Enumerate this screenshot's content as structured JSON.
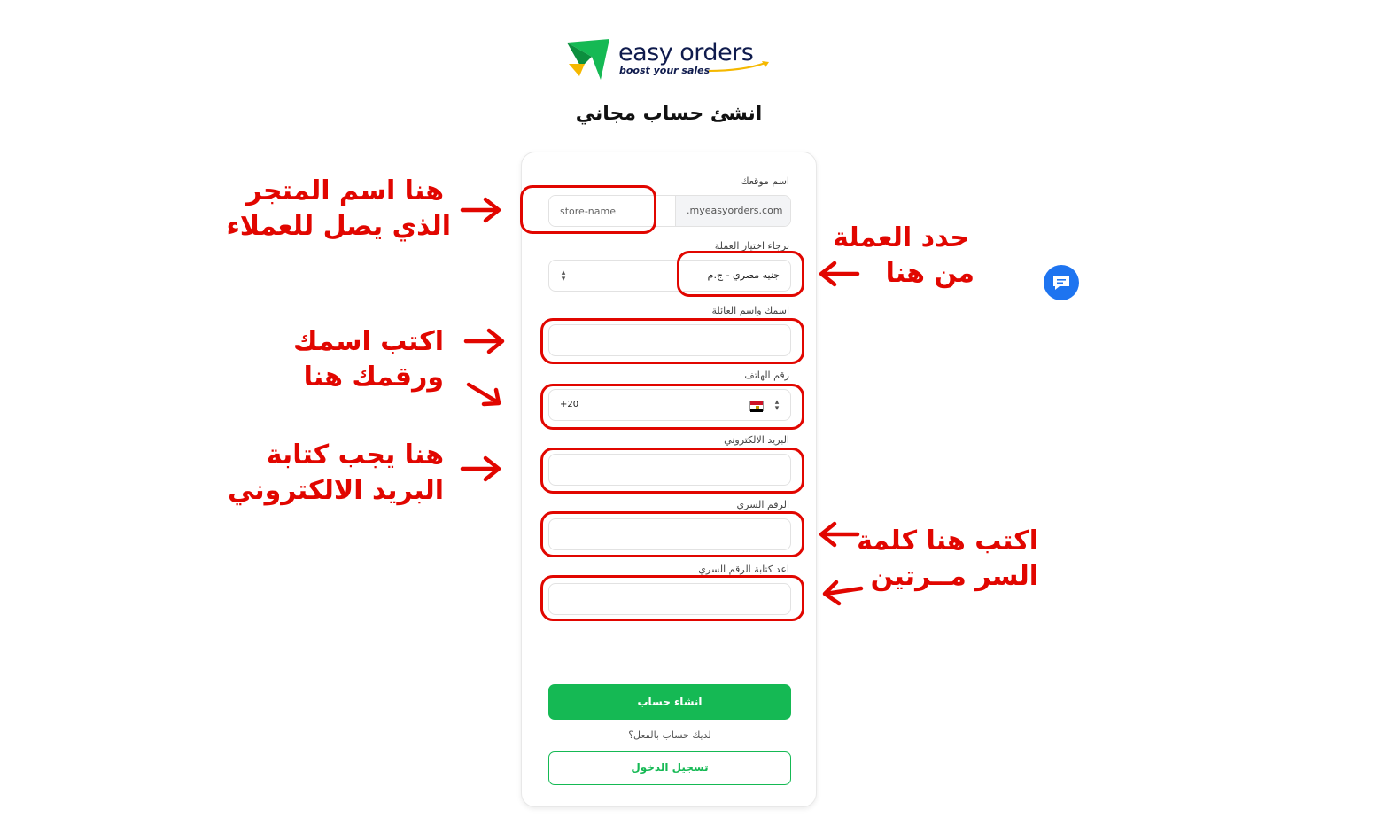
{
  "brand": {
    "name": "easy orders",
    "tagline": "boost your sales",
    "colors": {
      "green": "#15b954",
      "navy": "#0f1b4d",
      "accent_yellow": "#f5b800"
    }
  },
  "page_title": "انشئ حساب مجاني",
  "form": {
    "site_name_label": "اسم موقعك",
    "store_name_placeholder": "store-name",
    "domain_suffix": ".myeasyorders.com",
    "currency_label": "برجاء اختيار العملة",
    "currency_value": "جنيه مصري - ج.م",
    "full_name_label": "اسمك واسم العائلة",
    "phone_label": "رقم الهاتف",
    "phone_code": "+20",
    "email_label": "البريد الالكتروني",
    "password_label": "الرقم السري",
    "confirm_password_label": "اعد كتابة الرقم السري",
    "create_button": "انشاء حساب",
    "have_account_text": "لديك حساب بالفعل؟",
    "login_button": "تسجيل الدخول"
  },
  "annotations": {
    "store_name_line1": "هنا اسم المتجر",
    "store_name_line2": "الذي يصل للعملاء",
    "currency_line1": "حدد العملة",
    "currency_line2": "من هنا",
    "name_phone_line1": "اكتب اسمك",
    "name_phone_line2": "ورقمك هنا",
    "email_line1": "هنا يجب كتابة",
    "email_line2": "البريد الالكتروني",
    "password_line1": "اكتب هنا كلمة",
    "password_line2": "السر مــرتين",
    "color": "#e10600"
  },
  "chat_widget": {
    "icon": "chat-bubble-icon",
    "color": "#1e74f0"
  }
}
